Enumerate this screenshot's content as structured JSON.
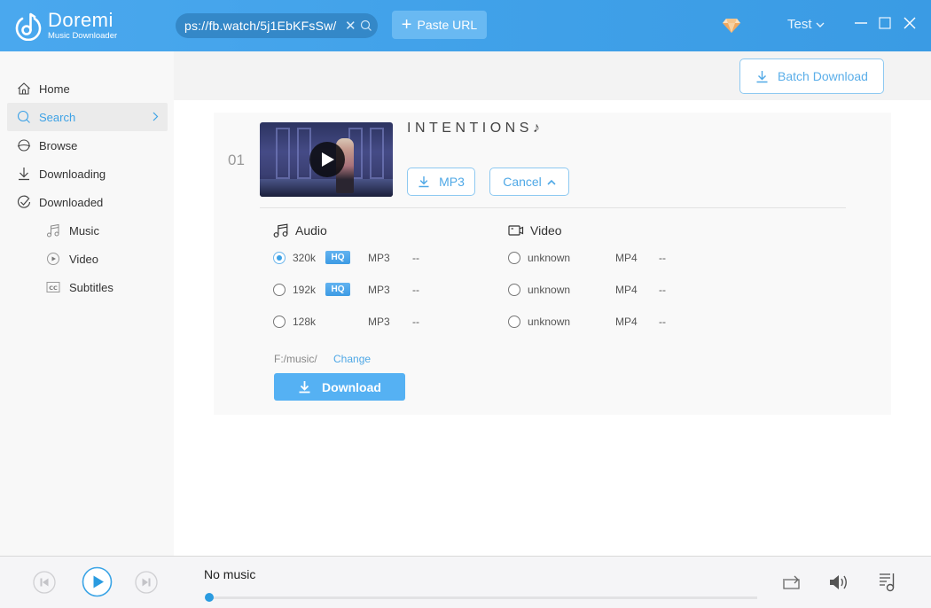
{
  "app": {
    "name": "Doremi",
    "subtitle": "Music Downloader",
    "user": "Test"
  },
  "search": {
    "url_value": "ps://fb.watch/5j1EbKFsSw/",
    "clear_icon": "close-icon",
    "search_icon": "search-icon"
  },
  "toolbar": {
    "paste_label": "Paste URL",
    "batch_label": "Batch Download"
  },
  "sidebar": {
    "items": [
      {
        "label": "Home",
        "icon": "home-icon"
      },
      {
        "label": "Search",
        "icon": "search-icon",
        "active": true
      },
      {
        "label": "Browse",
        "icon": "planet-icon"
      },
      {
        "label": "Downloading",
        "icon": "download-icon"
      },
      {
        "label": "Downloaded",
        "icon": "check-circle-icon"
      },
      {
        "label": "Music",
        "icon": "music-note-icon"
      },
      {
        "label": "Video",
        "icon": "play-circle-icon"
      },
      {
        "label": "Subtitles",
        "icon": "cc-icon"
      }
    ]
  },
  "result": {
    "index": "01",
    "title": "INTENTIONS♪",
    "format_button": "MP3",
    "cancel_button": "Cancel",
    "audio": {
      "heading": "Audio",
      "options": [
        {
          "quality": "320k",
          "hq": "HQ",
          "format": "MP3",
          "size": "--",
          "selected": true
        },
        {
          "quality": "192k",
          "hq": "HQ",
          "format": "MP3",
          "size": "--",
          "selected": false
        },
        {
          "quality": "128k",
          "hq": "",
          "format": "MP3",
          "size": "--",
          "selected": false
        }
      ]
    },
    "video": {
      "heading": "Video",
      "options": [
        {
          "quality": "unknown",
          "format": "MP4",
          "size": "--",
          "selected": false
        },
        {
          "quality": "unknown",
          "format": "MP4",
          "size": "--",
          "selected": false
        },
        {
          "quality": "unknown",
          "format": "MP4",
          "size": "--",
          "selected": false
        }
      ]
    },
    "save_path": "F:/music/",
    "change_label": "Change",
    "download_label": "Download"
  },
  "player": {
    "now_playing": "No music",
    "progress": 0
  },
  "colors": {
    "accent": "#3da2e6",
    "titlebar": "#43a3ea",
    "download_button": "#55b1f3"
  }
}
